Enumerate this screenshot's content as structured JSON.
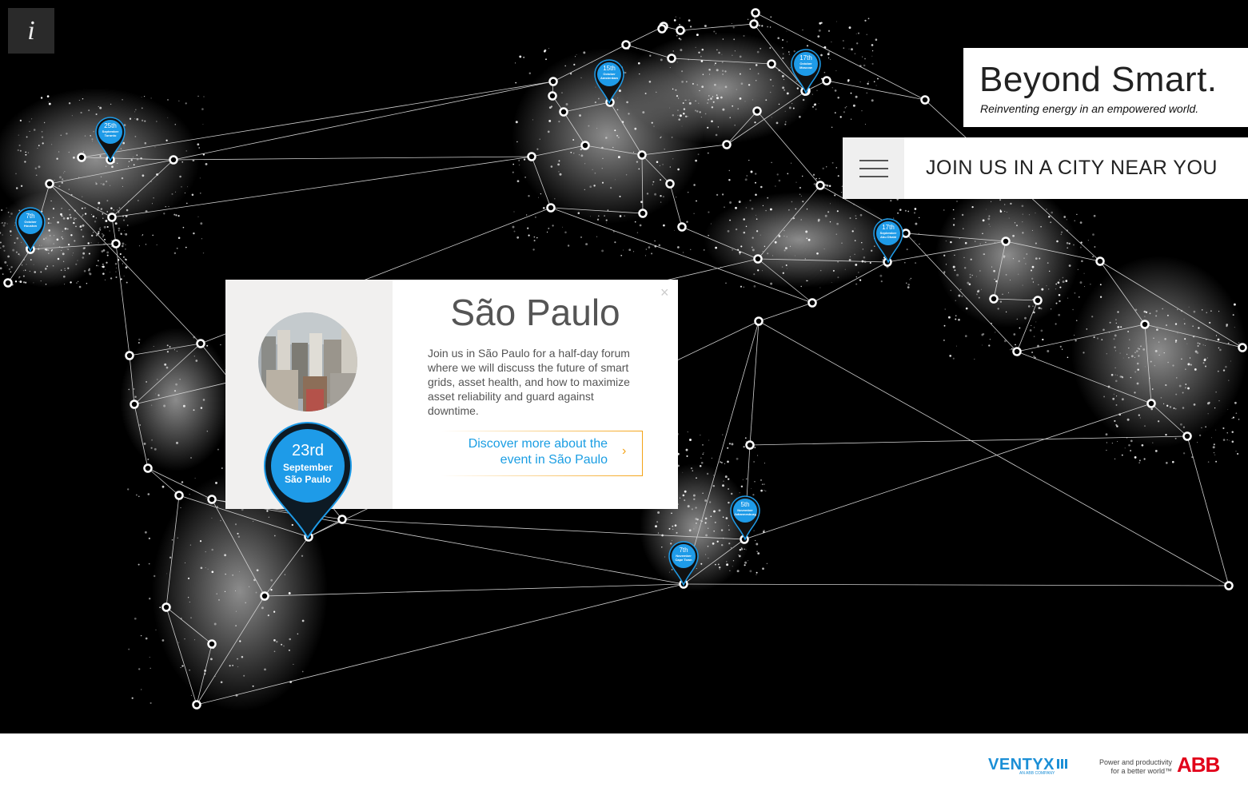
{
  "info_button": {
    "label": "i"
  },
  "brand": {
    "title": "Beyond Smart.",
    "tagline": "Reinventing energy in an empowered world."
  },
  "join_bar": {
    "label": "JOIN US IN A CITY NEAR YOU"
  },
  "pins": [
    {
      "day": "25th",
      "month": "September",
      "city": "Toronto"
    },
    {
      "day": "7th",
      "month": "October",
      "city": "Houston"
    },
    {
      "day": "15th",
      "month": "October",
      "city": "Amsterdam"
    },
    {
      "day": "17th",
      "month": "October",
      "city": "Moscow"
    },
    {
      "day": "17th",
      "month": "September",
      "city": "Abu Dhabi"
    },
    {
      "day": "5th",
      "month": "November",
      "city": "Johannesburg"
    },
    {
      "day": "7th",
      "month": "November",
      "city": "Cape Town"
    }
  ],
  "popup": {
    "city": "São Paulo",
    "description": "Join us in São Paulo for a half-day forum where we will discuss the future of smart grids, asset health, and how to maximize asset reliability and guard against downtime.",
    "cta_line1": "Discover more about the",
    "cta_line2": "event in São Paulo",
    "close": "×",
    "pin": {
      "day": "23rd",
      "month": "September",
      "city": "São Paulo"
    }
  },
  "footer": {
    "ventyx": "VENTYX",
    "ventyx_sub": "AN ABB COMPANY",
    "abb_tag_line1": "Power and productivity",
    "abb_tag_line2": "for a better world™",
    "abb": "ABB"
  },
  "colors": {
    "pin_blue": "#1e9be8",
    "accent_orange": "#f4a316",
    "link_blue": "#1b9ee3",
    "abb_red": "#e2001a"
  }
}
